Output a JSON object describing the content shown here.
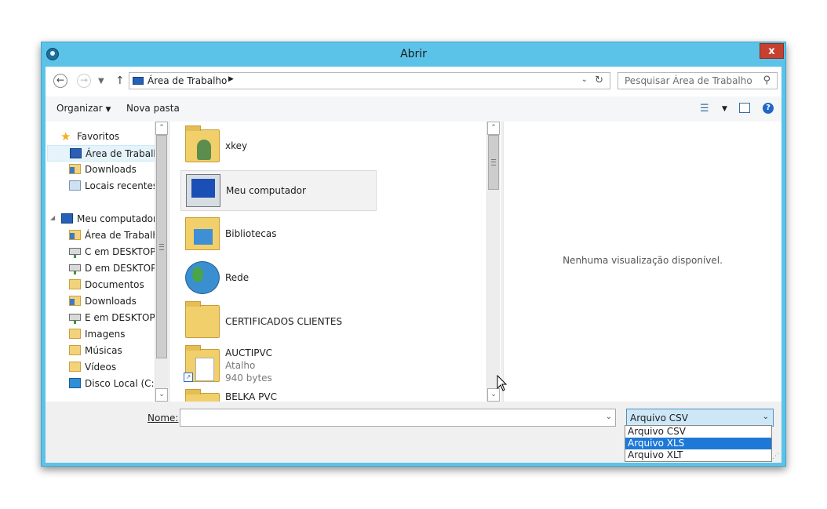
{
  "window": {
    "title": "Abrir",
    "close_label": "x"
  },
  "address_bar": {
    "path_segment": "Área de Trabalho",
    "search_placeholder": "Pesquisar Área de Trabalho"
  },
  "toolbar": {
    "organize_label": "Organizar",
    "new_folder_label": "Nova pasta",
    "help_label": "?"
  },
  "nav": {
    "favorites_label": "Favoritos",
    "favorites": [
      {
        "label": "Área de Trabalho",
        "icon": "desktop-icon"
      },
      {
        "label": "Downloads",
        "icon": "downloads-icon"
      },
      {
        "label": "Locais recentes",
        "icon": "recent-places-icon"
      }
    ],
    "computer_label": "Meu computador",
    "computer_items": [
      {
        "label": "Área de Trabalho",
        "icon": "desktop-folder-icon"
      },
      {
        "label": "C em DESKTOP-I",
        "icon": "network-drive-icon"
      },
      {
        "label": "D em DESKTOP-I",
        "icon": "network-drive-icon"
      },
      {
        "label": "Documentos",
        "icon": "documents-icon"
      },
      {
        "label": "Downloads",
        "icon": "downloads-icon"
      },
      {
        "label": "E em DESKTOP-N",
        "icon": "network-drive-icon"
      },
      {
        "label": "Imagens",
        "icon": "pictures-icon"
      },
      {
        "label": "Músicas",
        "icon": "music-icon"
      },
      {
        "label": "Vídeos",
        "icon": "videos-icon"
      },
      {
        "label": "Disco Local (C:)",
        "icon": "local-disk-icon"
      }
    ]
  },
  "files": [
    {
      "name": "xkey",
      "icon": "user-folder-icon"
    },
    {
      "name": "Meu computador",
      "icon": "computer-icon"
    },
    {
      "name": "Bibliotecas",
      "icon": "libraries-icon"
    },
    {
      "name": "Rede",
      "icon": "network-icon"
    },
    {
      "name": "CERTIFICADOS CLIENTES",
      "icon": "folder-icon"
    },
    {
      "name": "AUCTIPVC",
      "type": "Atalho",
      "size": "940 bytes",
      "icon": "shortcut-icon"
    },
    {
      "name": "BELKA PVC",
      "icon": "folder-icon"
    }
  ],
  "preview": {
    "message": "Nenhuma visualização disponível."
  },
  "bottom": {
    "name_label": "Nome:",
    "name_value": "",
    "file_type_selected": "Arquivo CSV",
    "file_type_options": [
      "Arquivo CSV",
      "Arquivo XLS",
      "Arquivo XLT"
    ],
    "highlighted_option_index": 1
  }
}
